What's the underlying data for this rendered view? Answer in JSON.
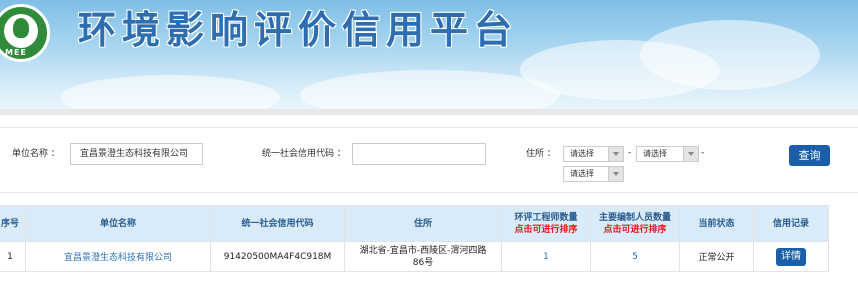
{
  "header": {
    "title": "环境影响评价信用平台",
    "logo_text": "MEE"
  },
  "search": {
    "unit_name_label": "单位名称 ：",
    "unit_name_value": "宜昌景澄生态科技有限公司",
    "credit_code_label": "统一社会信用代码 ：",
    "credit_code_value": "",
    "address_label": "住所 ：",
    "province_select": "请选择",
    "city_select": "请选择",
    "district_select": "请选择",
    "dash1": "-",
    "dash2": "-",
    "query_button": "查询"
  },
  "table": {
    "headers": {
      "index": "序号",
      "unit_name": "单位名称",
      "credit_code": "统一社会信用代码",
      "address": "住所",
      "engineer_count": "环评工程师数量",
      "engineer_sort": "点击可进行排序",
      "staff_count": "主要编制人员数量",
      "staff_sort": "点击可进行排序",
      "status": "当前状态",
      "credit_record": "信用记录"
    },
    "rows": [
      {
        "index": "1",
        "unit_name": "宜昌景澄生态科技有限公司",
        "credit_code": "91420500MA4F4C918M",
        "address_line1": "湖北省-宜昌市-西陵区-渭河四路",
        "address_line2": "86号",
        "engineer_count": "1",
        "staff_count": "5",
        "status": "正常公开",
        "detail_button": "详情"
      }
    ]
  }
}
